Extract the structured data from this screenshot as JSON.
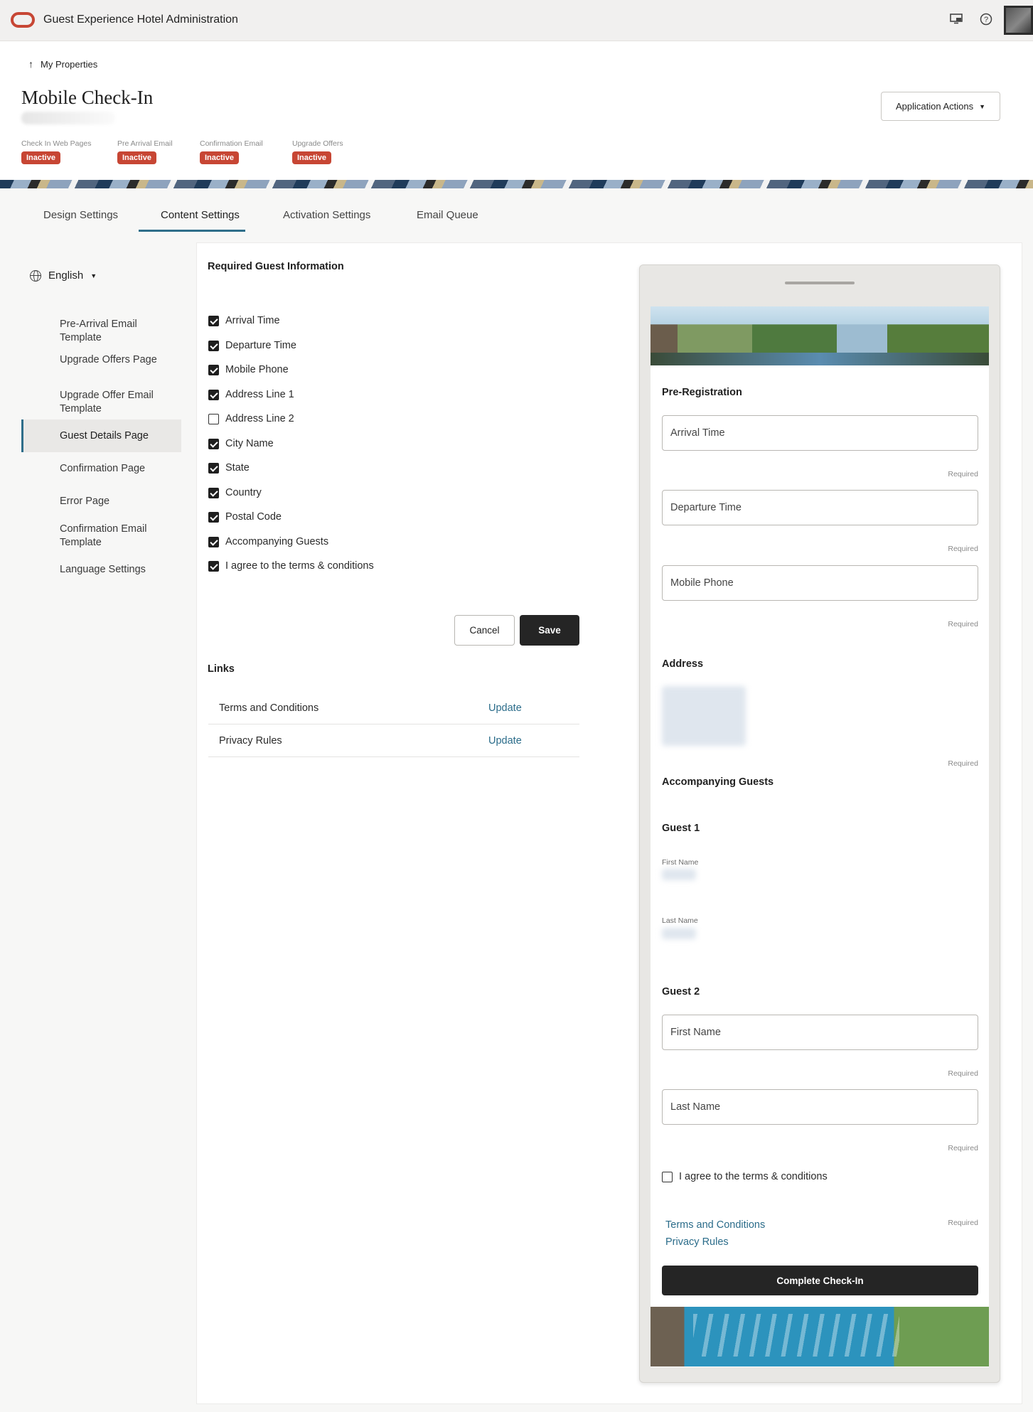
{
  "app": {
    "title": "Guest Experience Hotel Administration",
    "brand_color": "#c74634",
    "icons": [
      "screen-share-icon",
      "help-icon"
    ]
  },
  "header": {
    "back_label": "My Properties",
    "page_title": "Mobile Check-In",
    "actions_label": "Application Actions",
    "statuses": [
      {
        "label": "Check In Web Pages",
        "badge": "Inactive"
      },
      {
        "label": "Pre Arrival Email",
        "badge": "Inactive"
      },
      {
        "label": "Confirmation Email",
        "badge": "Inactive"
      },
      {
        "label": "Upgrade Offers",
        "badge": "Inactive"
      }
    ]
  },
  "tabs": [
    {
      "label": "Design Settings"
    },
    {
      "label": "Content Settings",
      "active": true
    },
    {
      "label": "Activation Settings"
    },
    {
      "label": "Email Queue"
    }
  ],
  "sidebar": {
    "language": "English",
    "items": [
      {
        "label": "Pre-Arrival Email Template"
      },
      {
        "label": "Upgrade Offers Page"
      },
      {
        "label": "Upgrade Offer Email Template"
      },
      {
        "label": "Guest Details Page",
        "active": true
      },
      {
        "label": "Confirmation Page"
      },
      {
        "label": "Error Page"
      },
      {
        "label": "Confirmation Email Template"
      },
      {
        "label": "Language Settings"
      }
    ]
  },
  "required_info": {
    "title": "Required Guest Information",
    "fields": [
      {
        "label": "Arrival Time",
        "checked": true
      },
      {
        "label": "Departure Time",
        "checked": true
      },
      {
        "label": "Mobile Phone",
        "checked": true
      },
      {
        "label": "Address Line 1",
        "checked": true
      },
      {
        "label": "Address Line 2",
        "checked": false
      },
      {
        "label": "City Name",
        "checked": true
      },
      {
        "label": "State",
        "checked": true
      },
      {
        "label": "Country",
        "checked": true
      },
      {
        "label": "Postal Code",
        "checked": true
      },
      {
        "label": "Accompanying Guests",
        "checked": true
      },
      {
        "label": "I agree to the terms & conditions",
        "checked": true
      }
    ],
    "cancel_label": "Cancel",
    "save_label": "Save"
  },
  "links": {
    "title": "Links",
    "rows": [
      {
        "name": "Terms and Conditions",
        "action": "Update"
      },
      {
        "name": "Privacy Rules",
        "action": "Update"
      }
    ]
  },
  "preview": {
    "pre_registration": "Pre-Registration",
    "arrival_placeholder": "Arrival Time",
    "departure_placeholder": "Departure Time",
    "mobile_placeholder": "Mobile Phone",
    "required": "Required",
    "address_title": "Address",
    "accompanying_title": "Accompanying Guests",
    "guest1_title": "Guest 1",
    "first_name_label": "First Name",
    "last_name_label": "Last Name",
    "guest2_title": "Guest 2",
    "guest2_first_placeholder": "First Name",
    "guest2_last_placeholder": "Last Name",
    "agree_label": "I agree to the terms & conditions",
    "terms_link": "Terms and Conditions",
    "privacy_link": "Privacy Rules",
    "complete_label": "Complete Check-In"
  }
}
